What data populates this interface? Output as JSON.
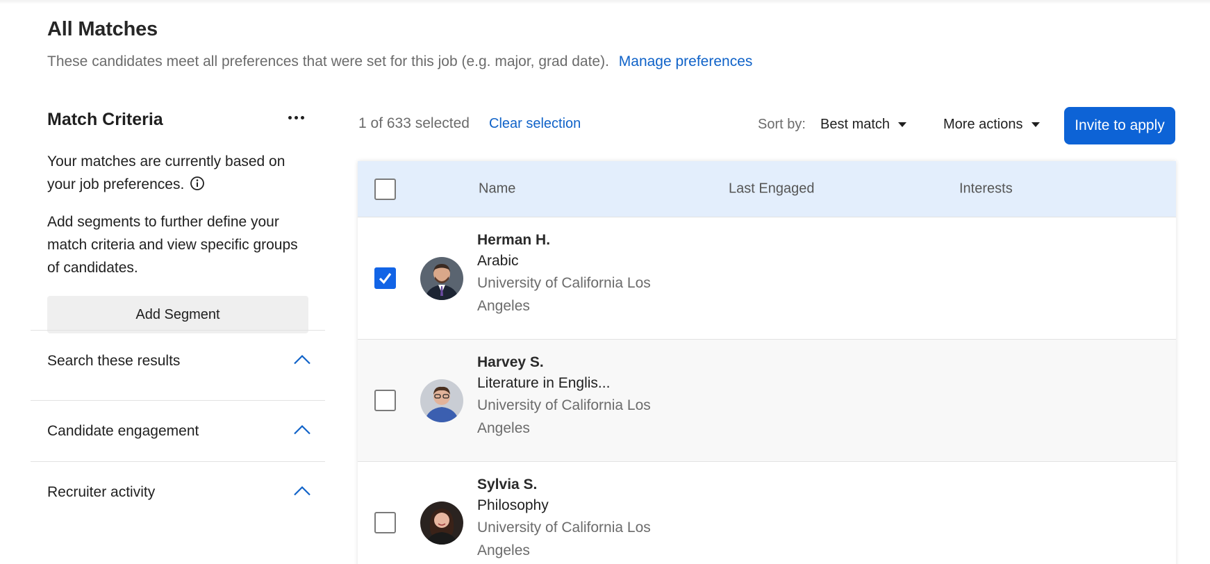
{
  "header": {
    "title": "All Matches",
    "subtitle": "These candidates meet all preferences that were set for this job (e.g. major, grad date).",
    "manage_link": "Manage preferences"
  },
  "sidebar": {
    "title": "Match Criteria",
    "more_icon": "ellipsis-icon",
    "paragraph1": "Your matches are currently based on your job preferences.",
    "info_icon": "info-icon",
    "paragraph2": "Add segments to further define your match criteria and view specific groups of candidates.",
    "add_segment_label": "Add Segment",
    "accordions": [
      {
        "label": "Search these results",
        "icon": "chevron-up-icon"
      },
      {
        "label": "Candidate engagement",
        "icon": "chevron-up-icon"
      },
      {
        "label": "Recruiter activity",
        "icon": "chevron-up-icon"
      }
    ]
  },
  "toolbar": {
    "selected_text": "1 of 633 selected",
    "clear_selection": "Clear selection",
    "sort_label": "Sort by:",
    "sort_value": "Best match",
    "more_actions": "More actions",
    "invite_label": "Invite to apply"
  },
  "table": {
    "columns": [
      "Name",
      "Last Engaged",
      "Interests"
    ],
    "rows": [
      {
        "name": "Herman H.",
        "major": "Arabic",
        "school": "University of California Los Angeles",
        "selected": true
      },
      {
        "name": "Harvey S.",
        "major": "Literature in Englis...",
        "school": "University of California Los Angeles",
        "selected": false
      },
      {
        "name": "Sylvia S.",
        "major": "Philosophy",
        "school": "University of California Los Angeles",
        "selected": false
      }
    ]
  },
  "colors": {
    "accent": "#0f62c8",
    "button": "#0d63d6",
    "header_bg": "#e3eefc"
  }
}
